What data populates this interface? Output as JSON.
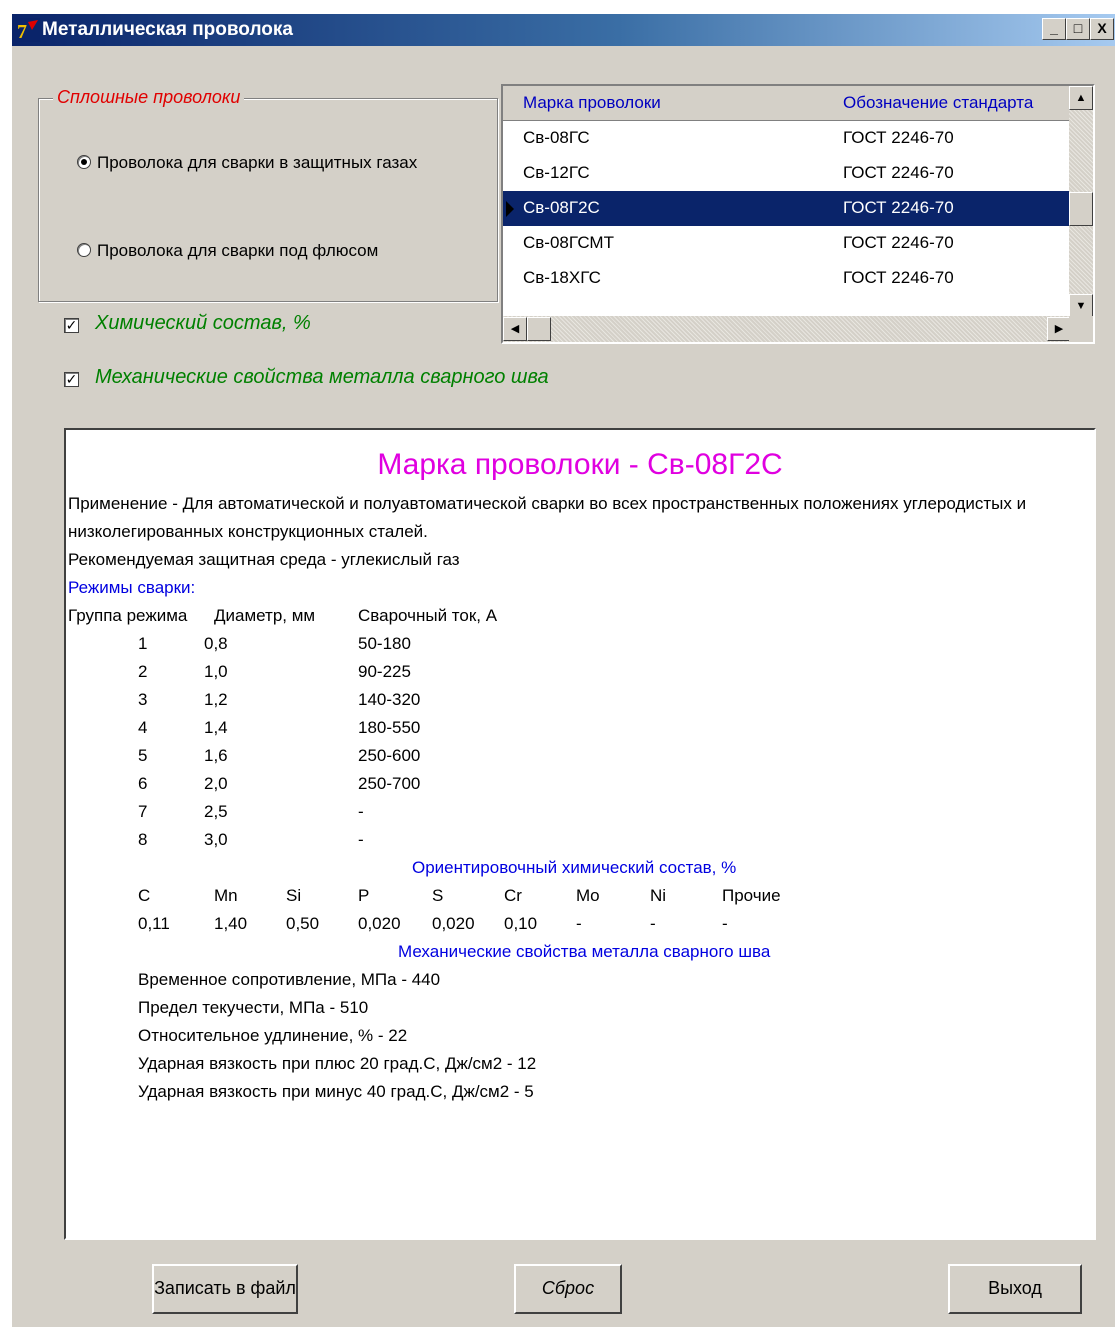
{
  "window": {
    "title": "Металлическая проволока"
  },
  "wire_group": {
    "legend": "Сплошные проволоки",
    "options": [
      {
        "label": "Проволока для сварки в защитных газах",
        "selected": true
      },
      {
        "label": "Проволока для сварки под флюсом",
        "selected": false
      }
    ]
  },
  "checks": [
    {
      "label": "Химический состав, %",
      "checked": true
    },
    {
      "label": "Механические свойства металла сварного шва",
      "checked": true
    }
  ],
  "grid": {
    "columns": [
      "Марка проволоки",
      "Обозначение стандарта"
    ],
    "rows": [
      [
        "Св-08ГС",
        "ГОСТ 2246-70"
      ],
      [
        "Св-12ГС",
        "ГОСТ 2246-70"
      ],
      [
        "Св-08Г2С",
        "ГОСТ 2246-70"
      ],
      [
        "Св-08ГСМТ",
        "ГОСТ 2246-70"
      ],
      [
        "Св-18ХГС",
        "ГОСТ 2246-70"
      ]
    ],
    "selected_index": 2
  },
  "report": {
    "title": "Марка проволоки - Св-08Г2С",
    "application_1": "Применение - Для автоматической и полуавтоматической сварки во всех пространственных положениях углеродистых и",
    "application_2": "низколегированных конструкционных сталей.",
    "shield": "Рекомендуемая защитная среда - углекислый газ",
    "modes_heading": "Режимы сварки:",
    "modes_columns": [
      "Группа режима",
      "Диаметр, мм",
      "Сварочный ток, А"
    ],
    "modes": [
      [
        "1",
        "0,8",
        "50-180"
      ],
      [
        "2",
        "1,0",
        "90-225"
      ],
      [
        "3",
        "1,2",
        "140-320"
      ],
      [
        "4",
        "1,4",
        "180-550"
      ],
      [
        "5",
        "1,6",
        "250-600"
      ],
      [
        "6",
        "2,0",
        "250-700"
      ],
      [
        "7",
        "2,5",
        "-"
      ],
      [
        "8",
        "3,0",
        "-"
      ]
    ],
    "chem_heading": "Ориентировочный химический состав, %",
    "chem_elements": [
      "C",
      "Mn",
      "Si",
      "P",
      "S",
      "Cr",
      "Mo",
      "Ni",
      "Прочие"
    ],
    "chem_values": [
      "0,11",
      "1,40",
      "0,50",
      "0,020",
      "0,020",
      "0,10",
      "-",
      "-",
      "-"
    ],
    "mech_heading": "Механические свойства металла сварного шва",
    "mech_props": [
      "Временное сопротивление, МПа  -  440",
      "Предел текучести, МПа  -  510",
      "Относительное удлинение, %  -  22",
      "Ударная вязкость при плюс 20 град.С, Дж/см2  -  12",
      "Ударная вязкость при минус 40 град.С, Дж/см2  -  5"
    ]
  },
  "buttons": {
    "save": "Записать в файл",
    "reset": "Сброс",
    "exit": "Выход"
  }
}
